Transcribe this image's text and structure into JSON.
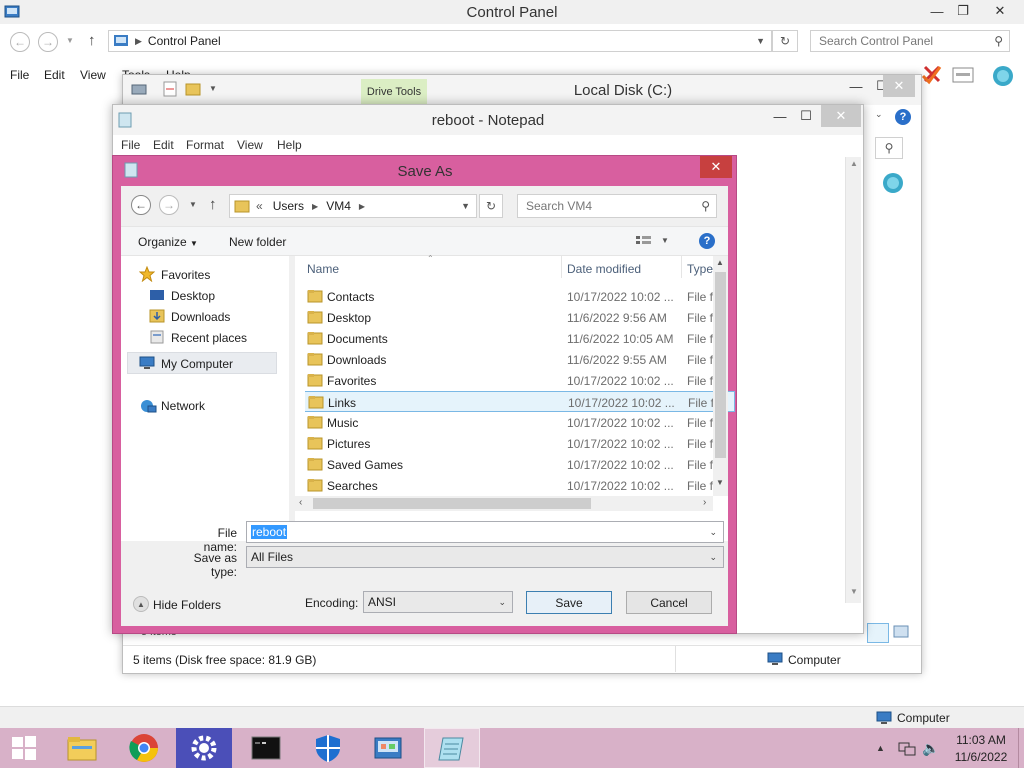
{
  "control_panel": {
    "title": "Control Panel",
    "breadcrumb": "Control Panel",
    "search_placeholder": "Search Control Panel",
    "menu": [
      "File",
      "Edit",
      "View",
      "Tools",
      "Help"
    ],
    "status_computer": "Computer"
  },
  "explorer": {
    "title": "Local Disk (C:)",
    "ribbon_tab": "Drive Tools",
    "status_items": "5 items (Disk free space: 81.9 GB)",
    "status_computer": "Computer",
    "behind_text": "5 items"
  },
  "notepad": {
    "title": "reboot - Notepad",
    "menu": [
      "File",
      "Edit",
      "Format",
      "View",
      "Help"
    ]
  },
  "save_as": {
    "title": "Save As",
    "breadcrumb": [
      "Users",
      "VM4"
    ],
    "breadcrumb_prefix": "«",
    "search_placeholder": "Search VM4",
    "toolbar": {
      "organize": "Organize",
      "new_folder": "New folder"
    },
    "nav": {
      "favorites": "Favorites",
      "fav_items": [
        "Desktop",
        "Downloads",
        "Recent places"
      ],
      "my_computer": "My Computer",
      "network": "Network"
    },
    "columns": {
      "name": "Name",
      "date": "Date modified",
      "type": "Type"
    },
    "files": [
      {
        "name": "Contacts",
        "date": "10/17/2022 10:02 ...",
        "type": "File fol"
      },
      {
        "name": "Desktop",
        "date": "11/6/2022 9:56 AM",
        "type": "File fol"
      },
      {
        "name": "Documents",
        "date": "11/6/2022 10:05 AM",
        "type": "File fol"
      },
      {
        "name": "Downloads",
        "date": "11/6/2022 9:55 AM",
        "type": "File fol"
      },
      {
        "name": "Favorites",
        "date": "10/17/2022 10:02 ...",
        "type": "File fol"
      },
      {
        "name": "Links",
        "date": "10/17/2022 10:02 ...",
        "type": "File fol"
      },
      {
        "name": "Music",
        "date": "10/17/2022 10:02 ...",
        "type": "File fol"
      },
      {
        "name": "Pictures",
        "date": "10/17/2022 10:02 ...",
        "type": "File fol"
      },
      {
        "name": "Saved Games",
        "date": "10/17/2022 10:02 ...",
        "type": "File fol"
      },
      {
        "name": "Searches",
        "date": "10/17/2022 10:02 ...",
        "type": "File fol"
      }
    ],
    "selected_index": 5,
    "file_name_label": "File name:",
    "file_name_value": "reboot",
    "save_type_label": "Save as type:",
    "save_type_value": "All Files",
    "hide_folders": "Hide Folders",
    "encoding_label": "Encoding:",
    "encoding_value": "ANSI",
    "save_button": "Save",
    "cancel_button": "Cancel"
  },
  "desktop": {
    "computer_label": "Computer"
  },
  "taskbar": {
    "clock_time": "11:03 AM",
    "clock_date": "11/6/2022",
    "apps": [
      "file-explorer-icon",
      "chrome-icon",
      "settings-icon",
      "cmd-icon",
      "defender-icon",
      "control-panel-icon",
      "notepad-icon"
    ]
  },
  "colors": {
    "dialog_accent": "#d85f9f",
    "taskbar": "#d8b1c8",
    "selection": "#e5f3fb"
  }
}
